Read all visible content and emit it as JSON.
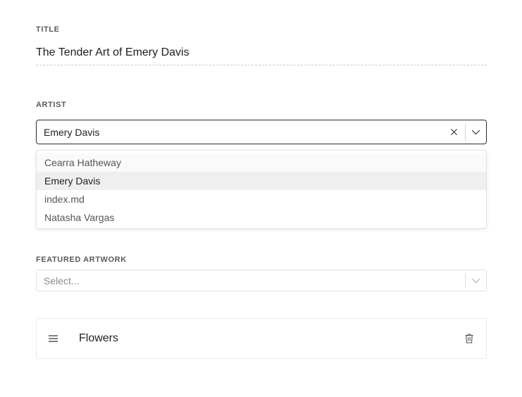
{
  "title_field": {
    "label": "TITLE",
    "value": "The Tender Art of Emery Davis"
  },
  "artist_field": {
    "label": "ARTIST",
    "value": "Emery Davis",
    "clear_icon": "close-icon",
    "toggle_icon": "chevron-down-icon",
    "options": [
      {
        "label": "Cearra Hatheway"
      },
      {
        "label": "Emery Davis"
      },
      {
        "label": "index.md"
      },
      {
        "label": "Natasha Vargas"
      }
    ],
    "selected_option": "Emery Davis"
  },
  "featured_artwork_field": {
    "label": "FEATURED ARTWORK",
    "placeholder": "Select...",
    "toggle_icon": "chevron-down-icon"
  },
  "list": {
    "items": [
      {
        "label": "Flowers",
        "handle_icon": "drag-handle-icon",
        "delete_icon": "trash-icon"
      }
    ]
  },
  "colors": {
    "border_active": "#2b2b2b",
    "border_muted": "#e0e0e0",
    "selected_bg": "#efefef",
    "label_text": "#5a5a5a"
  }
}
